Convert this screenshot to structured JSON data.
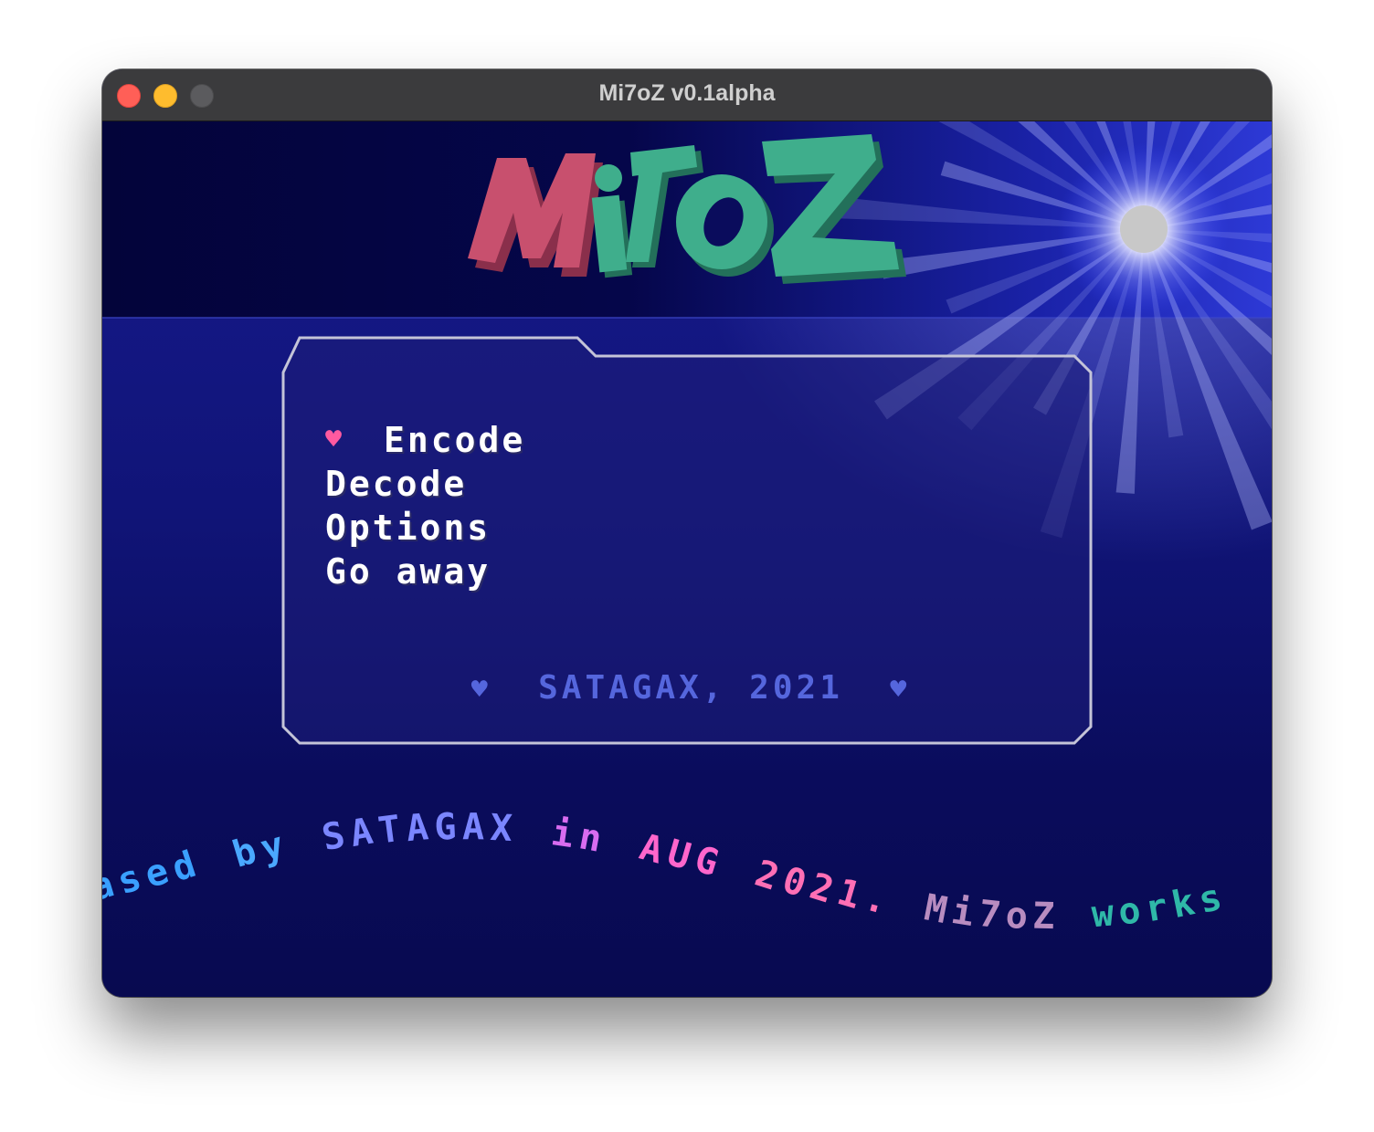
{
  "window": {
    "title": "Mi7oZ v0.1alpha"
  },
  "logo": {
    "text": "Mi7oZ",
    "colors": {
      "m": "#c8506e",
      "rest": "#3fae8c"
    }
  },
  "menu": {
    "selected_index": 0,
    "cursor_icon": "heart-icon",
    "cursor_glyph": "♥",
    "items": [
      {
        "label": "Encode"
      },
      {
        "label": "Decode"
      },
      {
        "label": "Options"
      },
      {
        "label": "Go away"
      }
    ]
  },
  "credit": {
    "text": "SATAGAX, 2021",
    "heart_glyph": "♥"
  },
  "scroller": {
    "segments": [
      {
        "text": "ased",
        "color": "#3aa0ff"
      },
      {
        "text": "by",
        "color": "#4aa8ff"
      },
      {
        "text": "SATAGAX",
        "color": "#7b86ff"
      },
      {
        "text": "in",
        "color": "#d86cf0"
      },
      {
        "text": "AUG",
        "color": "#ff66cc"
      },
      {
        "text": "2021.",
        "color": "#ff6fb5"
      },
      {
        "text": "Mi7oZ",
        "color": "#b88cc0"
      },
      {
        "text": "works",
        "color": "#2fb8a8"
      }
    ]
  },
  "colors": {
    "background": "#101477",
    "banner": "#05064a",
    "frame_border": "#c4c4d8",
    "menu_text": "#ffffff",
    "cursor": "#ff5aa0",
    "credit": "#5566dd"
  }
}
